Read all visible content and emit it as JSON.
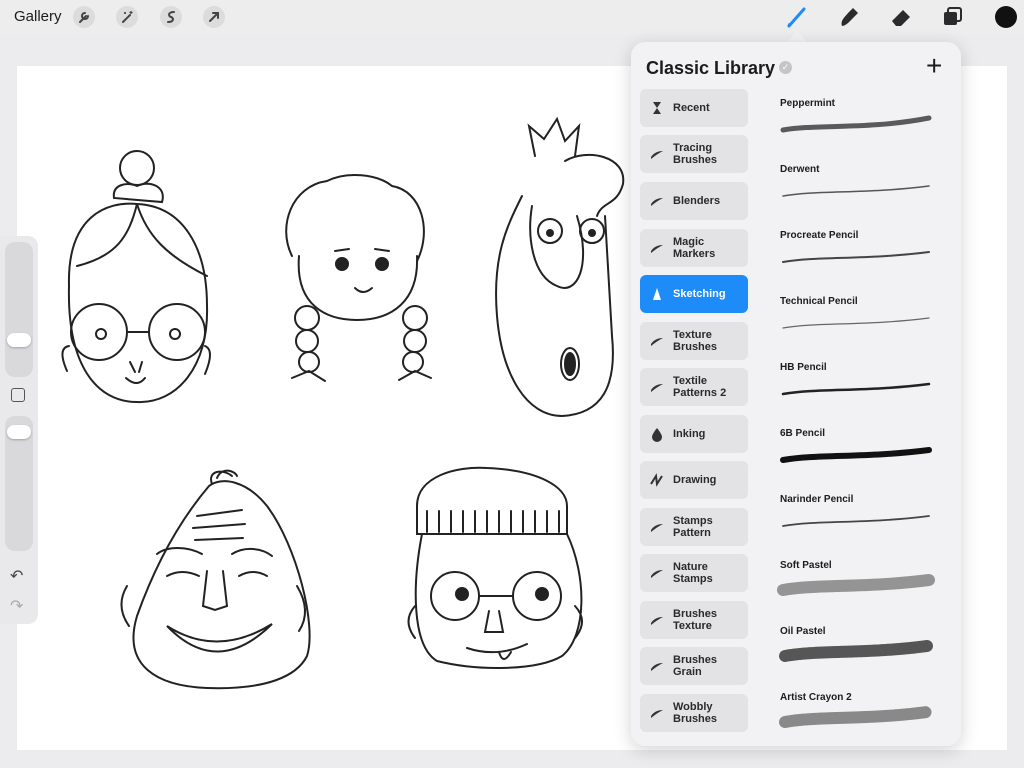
{
  "topbar": {
    "gallery_label": "Gallery",
    "left_tools": [
      "wrench-icon",
      "magic-wand-icon",
      "selection-icon",
      "transform-arrow-icon"
    ],
    "right_tools": [
      "brush-icon",
      "smudge-icon",
      "eraser-icon",
      "layers-icon"
    ],
    "active_tool": "brush-icon",
    "active_color": "#111111",
    "accent_color": "#1d8cf8"
  },
  "sidebar": {
    "undo_icon": "undo-icon",
    "redo_icon": "redo-icon"
  },
  "library": {
    "title": "Classic Library",
    "add_icon": "plus-icon",
    "groups": [
      {
        "label": "Recent",
        "icon": "hourglass-icon"
      },
      {
        "label": "Tracing\nBrushes",
        "icon": "stroke-icon"
      },
      {
        "label": "Blenders",
        "icon": "stroke-icon"
      },
      {
        "label": "Magic\nMarkers",
        "icon": "stroke-icon"
      },
      {
        "label": "Sketching",
        "icon": "pencil-tip-icon",
        "active": true
      },
      {
        "label": "Texture\nBrushes",
        "icon": "stroke-icon"
      },
      {
        "label": "Textile\nPatterns 2",
        "icon": "stroke-icon"
      },
      {
        "label": "Inking",
        "icon": "ink-drop-icon"
      },
      {
        "label": "Drawing",
        "icon": "scribble-icon"
      },
      {
        "label": "Stamps\nPattern",
        "icon": "stroke-icon"
      },
      {
        "label": "Nature\nStamps",
        "icon": "stroke-icon"
      },
      {
        "label": "Brushes\nTexture",
        "icon": "stroke-icon"
      },
      {
        "label": "Brushes\nGrain",
        "icon": "stroke-icon"
      },
      {
        "label": "Wobbly\nBrushes",
        "icon": "stroke-icon"
      }
    ],
    "brushes": [
      {
        "name": "Peppermint"
      },
      {
        "name": "Derwent"
      },
      {
        "name": "Procreate Pencil"
      },
      {
        "name": "Technical Pencil"
      },
      {
        "name": "HB Pencil"
      },
      {
        "name": "6B Pencil"
      },
      {
        "name": "Narinder Pencil"
      },
      {
        "name": "Soft Pastel"
      },
      {
        "name": "Oil Pastel"
      },
      {
        "name": "Artist Crayon 2"
      }
    ]
  }
}
